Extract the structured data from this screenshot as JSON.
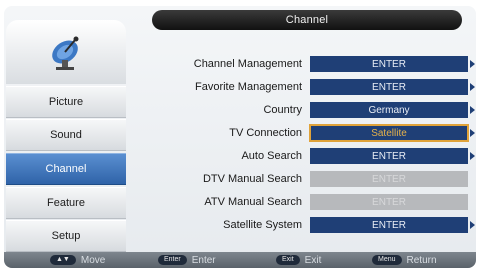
{
  "title": "Channel",
  "sidebar": {
    "logo_icon": "satellite-dish-icon",
    "items": [
      {
        "label": "Picture"
      },
      {
        "label": "Sound"
      },
      {
        "label": "Channel"
      },
      {
        "label": "Feature"
      },
      {
        "label": "Setup"
      }
    ],
    "active": "Channel"
  },
  "menu": {
    "rows": [
      {
        "label": "Channel Management",
        "value": "ENTER",
        "state": "normal"
      },
      {
        "label": "Favorite Management",
        "value": "ENTER",
        "state": "normal"
      },
      {
        "label": "Country",
        "value": "Germany",
        "state": "normal"
      },
      {
        "label": "TV Connection",
        "value": "Satellite",
        "state": "selected"
      },
      {
        "label": "Auto Search",
        "value": "ENTER",
        "state": "normal"
      },
      {
        "label": "DTV Manual Search",
        "value": "ENTER",
        "state": "disabled"
      },
      {
        "label": "ATV Manual Search",
        "value": "ENTER",
        "state": "disabled"
      },
      {
        "label": "Satellite System",
        "value": "ENTER",
        "state": "normal"
      }
    ]
  },
  "footer": {
    "hints": [
      {
        "key": "▲▼",
        "label": "Move"
      },
      {
        "key": "Enter",
        "label": "Enter"
      },
      {
        "key": "Exit",
        "label": "Exit"
      },
      {
        "key": "Menu",
        "label": "Return"
      }
    ]
  },
  "colors": {
    "accent": "#2f63a8",
    "value_bg": "#1f3f76",
    "selected_outline": "#e0a33a"
  }
}
